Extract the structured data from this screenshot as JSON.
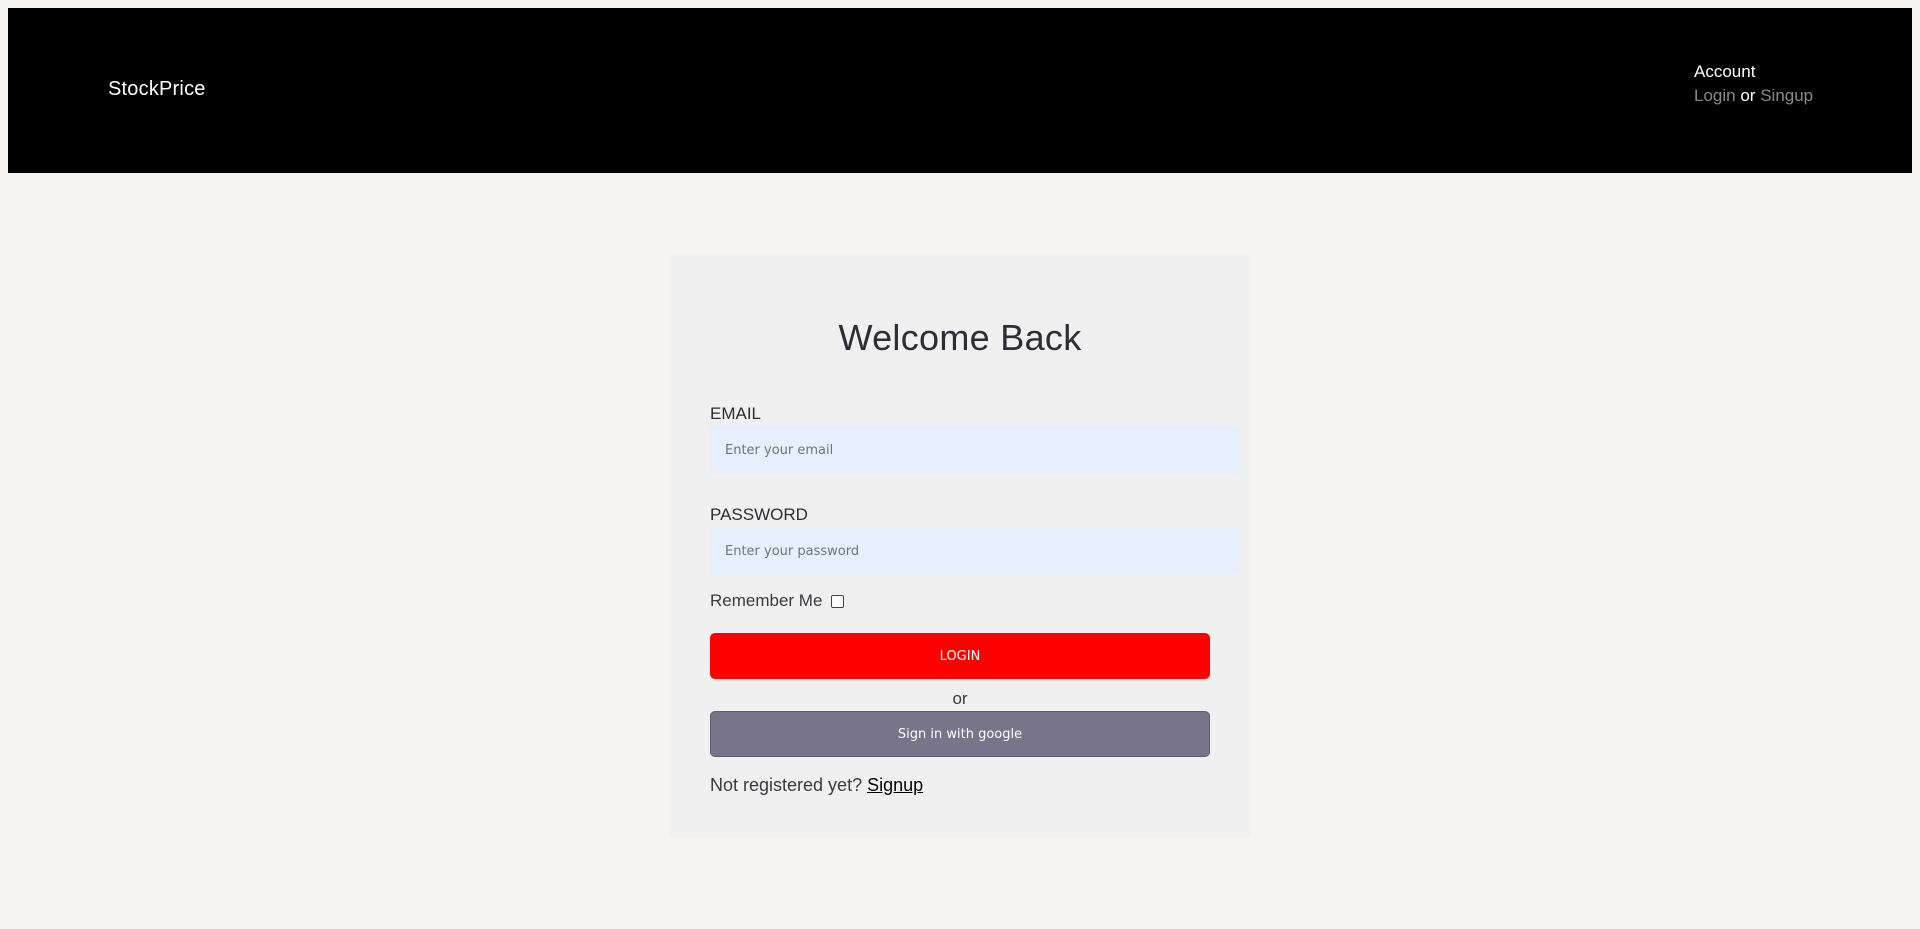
{
  "header": {
    "brand": "StockPrice",
    "account_title": "Account",
    "login_link": "Login",
    "or_text": "or",
    "signup_link": "Singup"
  },
  "form": {
    "title": "Welcome Back",
    "email_label": "EMAIL",
    "email_placeholder": "Enter your email",
    "email_value": "",
    "password_label": "PASSWORD",
    "password_placeholder": "Enter your password",
    "password_value": "",
    "remember_label": "Remember Me",
    "remember_checked": false,
    "login_button": "LOGIN",
    "or_text": "or",
    "google_button": "Sign in with google",
    "not_registered_text": "Not registered yet?",
    "signup_link": "Signup"
  },
  "colors": {
    "header_bg": "#000000",
    "page_bg": "#f5f4f2",
    "card_bg": "#f0f0f0",
    "input_bg": "#e8effc",
    "login_button_bg": "#ff0000",
    "google_button_bg": "#787489",
    "muted_link": "#8a8a8a"
  }
}
